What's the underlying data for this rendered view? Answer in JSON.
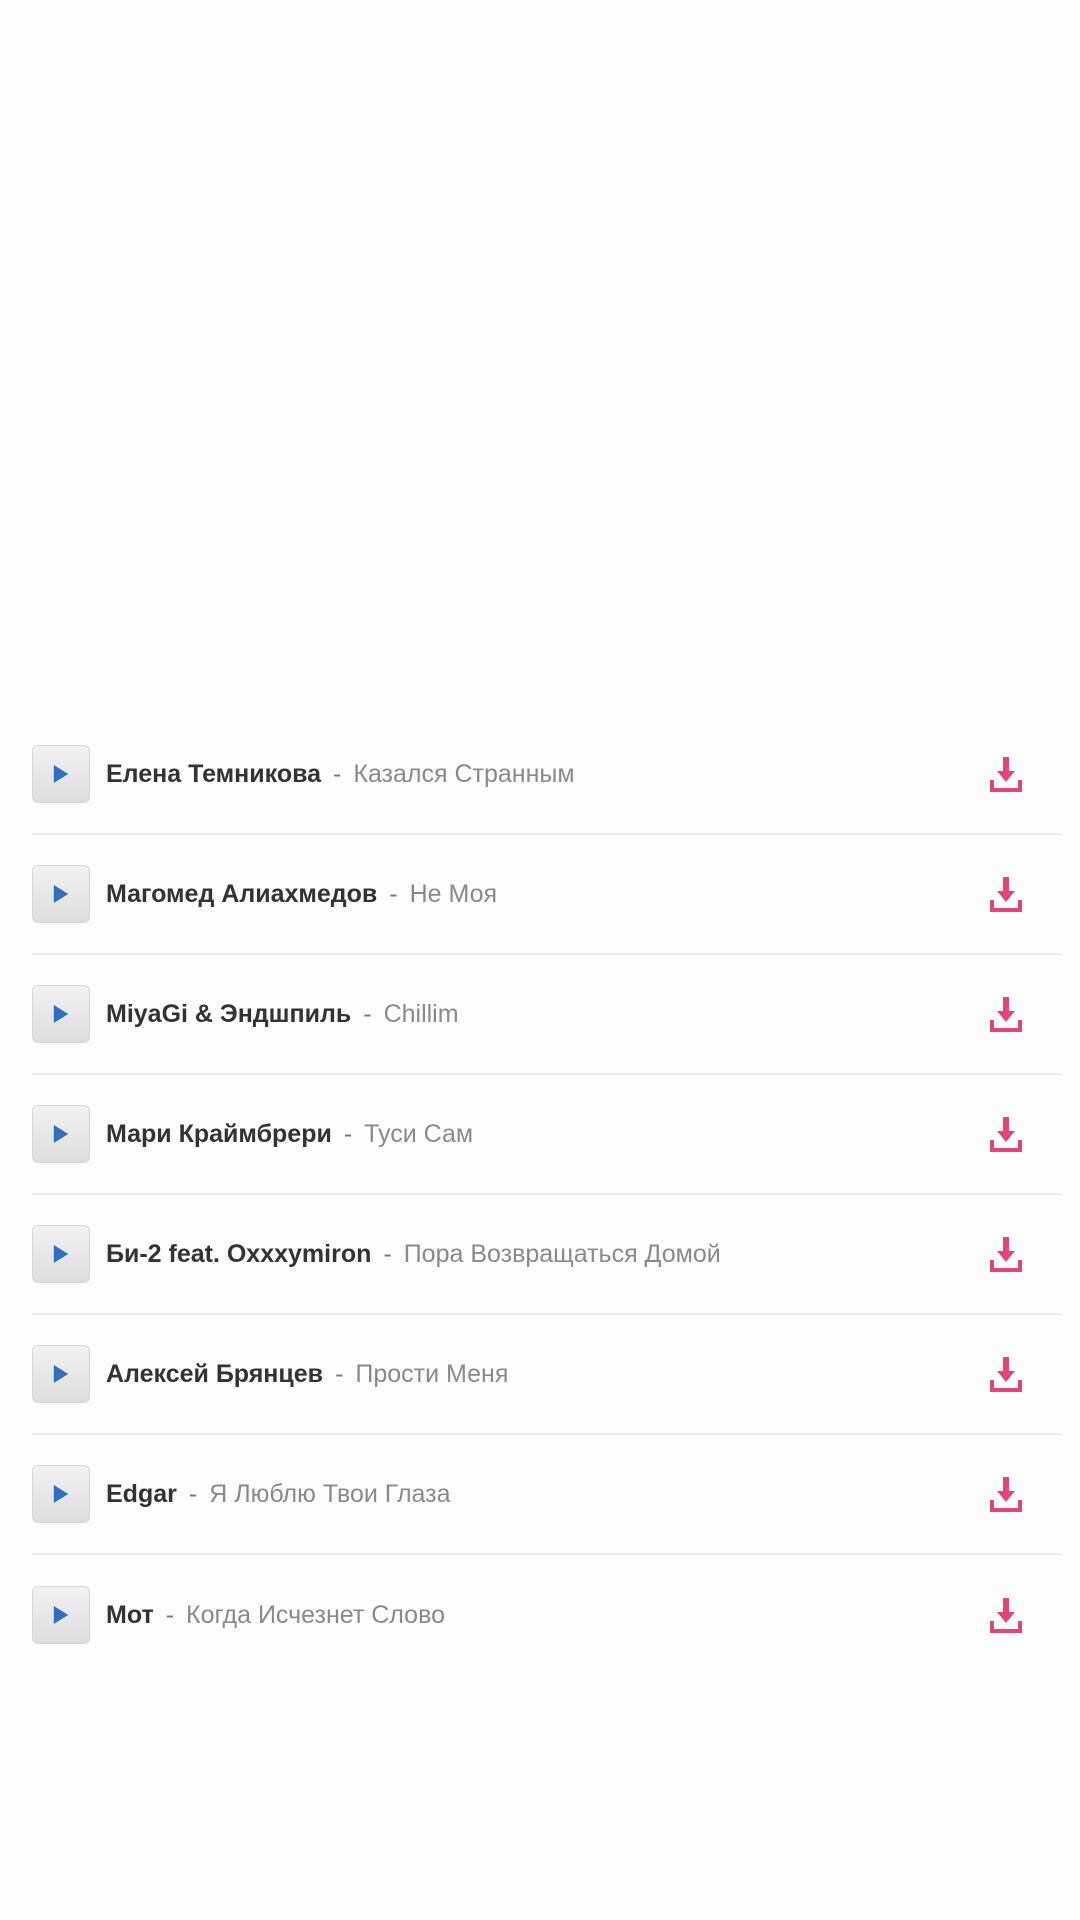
{
  "colors": {
    "background": "#fdfdfd",
    "play_icon": "#2f6fc0",
    "download_icon": "#e0457b",
    "artist_text": "#333333",
    "title_text": "#8a8a8a",
    "divider": "#ececec"
  },
  "icons": {
    "play": "play-icon",
    "download": "download-icon"
  },
  "separator": "-",
  "tracks": [
    {
      "artist": "Елена Темникова",
      "title": "Казался Странным"
    },
    {
      "artist": "Магомед Алиахмедов",
      "title": "Не Моя"
    },
    {
      "artist": "MiyaGi & Эндшпиль",
      "title": "Chillim"
    },
    {
      "artist": "Мари Краймбрери",
      "title": "Туси Сам"
    },
    {
      "artist": "Би-2 feat. Oxxxymiron",
      "title": "Пора Возвращаться Домой"
    },
    {
      "artist": "Алексей Брянцев",
      "title": "Прости Меня"
    },
    {
      "artist": "Edgar",
      "title": "Я Люблю Твои Глаза"
    },
    {
      "artist": "Мот",
      "title": "Когда Исчезнет Слово"
    }
  ]
}
